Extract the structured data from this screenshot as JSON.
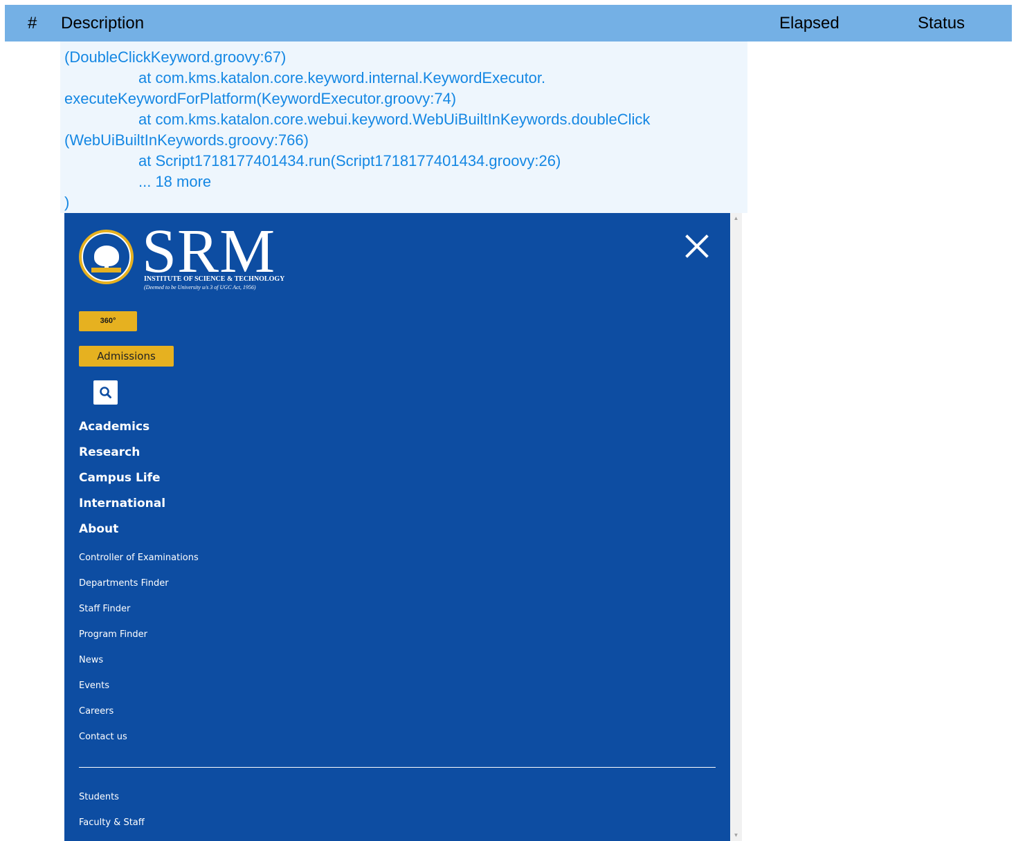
{
  "report_header": {
    "col_num": "#",
    "col_description": "Description",
    "col_elapsed": "Elapsed",
    "col_status": "Status"
  },
  "log": {
    "lines": [
      "(DoubleClickKeyword.groovy:67)",
      "at com.kms.katalon.core.keyword.internal.KeywordExecutor.",
      "executeKeywordForPlatform(KeywordExecutor.groovy:74)",
      "at com.kms.katalon.core.webui.keyword.WebUiBuiltInKeywords.doubleClick",
      "(WebUiBuiltInKeywords.groovy:766)",
      "at Script1718177401434.run(Script1718177401434.groovy:26)",
      "... 18 more",
      ")"
    ]
  },
  "site": {
    "logo": {
      "wordmark": "SRM",
      "line1": "INSTITUTE OF SCIENCE & TECHNOLOGY",
      "line2": "(Deemed to be University u/s 3 of UGC Act, 1956)"
    },
    "btn_360": "360°",
    "btn_admissions": "Admissions",
    "main_nav": [
      "Academics",
      "Research",
      "Campus Life",
      "International",
      "About"
    ],
    "sub_nav": [
      "Controller of Examinations",
      "Departments Finder",
      "Staff Finder",
      "Program Finder",
      "News",
      "Events",
      "Careers",
      "Contact us"
    ],
    "audience_nav": [
      "Students",
      "Faculty & Staff"
    ],
    "colors": {
      "background": "#0d4da2",
      "accent": "#e6b120",
      "text": "#ffffff"
    },
    "icons": {
      "close": "close-icon",
      "search": "search-icon"
    }
  }
}
